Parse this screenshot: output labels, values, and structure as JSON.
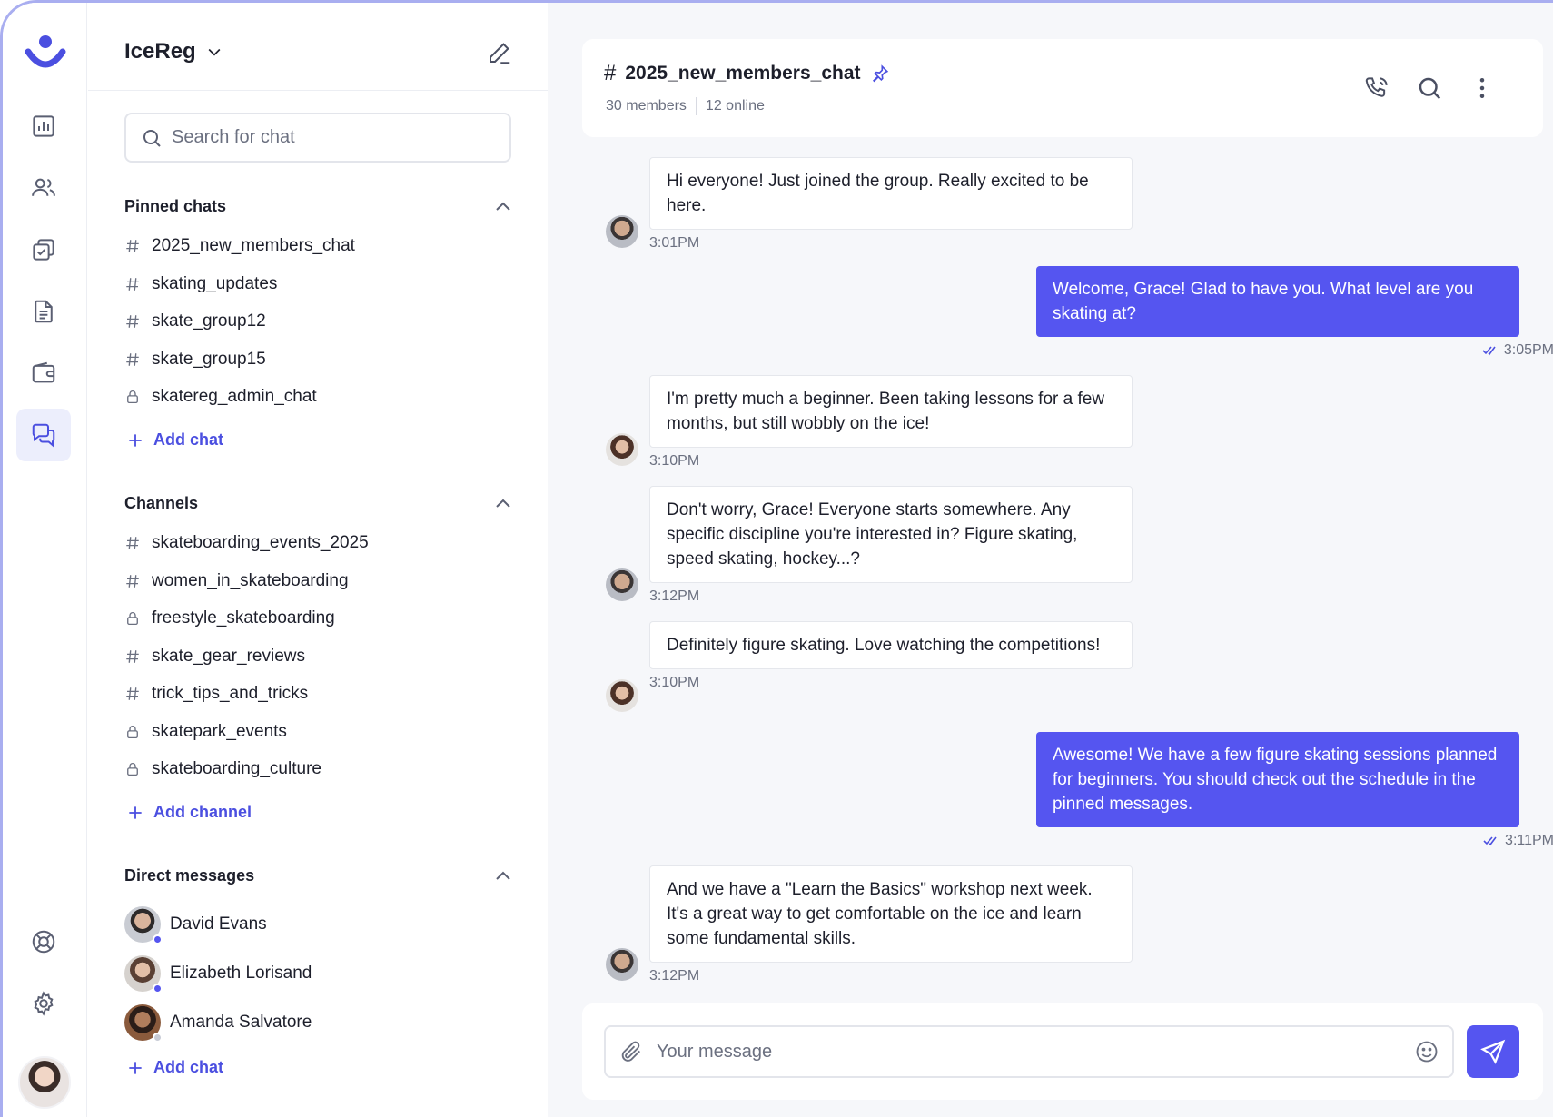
{
  "colors": {
    "accent": "#4b4fe0",
    "bubble_out": "#5555f0",
    "online": "#5555f0",
    "offline": "#c9ccd6"
  },
  "rail": {
    "items": [
      {
        "icon": "dashboard-chart-icon"
      },
      {
        "icon": "members-icon"
      },
      {
        "icon": "checklist-icon"
      },
      {
        "icon": "document-icon"
      },
      {
        "icon": "wallet-icon"
      },
      {
        "icon": "chat-bubbles-icon",
        "active": true
      }
    ],
    "bottom": [
      {
        "icon": "help-lifebuoy-icon"
      },
      {
        "icon": "settings-gear-icon"
      }
    ]
  },
  "sidebar": {
    "workspace": "IceReg",
    "search_placeholder": "Search for chat",
    "pinned": {
      "title": "Pinned chats",
      "items": [
        {
          "label": "2025_new_members_chat",
          "type": "hash"
        },
        {
          "label": "skating_updates",
          "type": "hash"
        },
        {
          "label": "skate_group12",
          "type": "hash"
        },
        {
          "label": "skate_group15",
          "type": "hash"
        },
        {
          "label": "skatereg_admin_chat",
          "type": "lock"
        }
      ],
      "add_label": "Add chat"
    },
    "channels": {
      "title": "Channels",
      "items": [
        {
          "label": "skateboarding_events_2025",
          "type": "hash"
        },
        {
          "label": "women_in_skateboarding",
          "type": "hash"
        },
        {
          "label": "freestyle_skateboarding",
          "type": "lock"
        },
        {
          "label": "skate_gear_reviews",
          "type": "hash"
        },
        {
          "label": "trick_tips_and_tricks",
          "type": "hash"
        },
        {
          "label": "skatepark_events",
          "type": "lock"
        },
        {
          "label": "skateboarding_culture",
          "type": "lock"
        }
      ],
      "add_label": "Add channel"
    },
    "direct": {
      "title": "Direct messages",
      "items": [
        {
          "name": "David Evans",
          "online": true
        },
        {
          "name": "Elizabeth Lorisand",
          "online": true
        },
        {
          "name": "Amanda Salvatore",
          "online": false
        }
      ],
      "add_label": "Add chat"
    }
  },
  "chat": {
    "hash": "#",
    "name": "2025_new_members_chat",
    "members": "30 members",
    "online": "12 online",
    "messages": [
      {
        "dir": "in",
        "text": "Hi everyone! Just joined the group. Really excited to be here.",
        "time": "3:01PM",
        "avatar": "man"
      },
      {
        "dir": "out",
        "text": "Welcome, Grace! Glad to have you. What level are you skating at?",
        "time": "3:05PM"
      },
      {
        "dir": "in",
        "text": "I'm pretty much a beginner.  Been taking lessons for a few months, but still wobbly on the ice!",
        "time": "3:10PM",
        "avatar": "woman"
      },
      {
        "dir": "in",
        "text": "Don't worry, Grace! Everyone starts somewhere.  Any specific discipline you're interested in? Figure skating, speed skating, hockey...?",
        "time": "3:12PM",
        "avatar": "man"
      },
      {
        "dir": "in",
        "text": "Definitely figure skating.  Love watching the competitions!",
        "time": "3:10PM",
        "avatar": "woman"
      },
      {
        "dir": "out",
        "text": "Awesome! We have a few figure skating sessions planned for beginners. You should check out the schedule in the pinned messages.",
        "time": "3:11PM"
      },
      {
        "dir": "in",
        "text": "And we have a \"Learn the Basics\" workshop next week.  It's a great way to get comfortable on the ice and learn some fundamental skills.",
        "time": "3:12PM",
        "avatar": "man"
      }
    ],
    "composer_placeholder": "Your message"
  }
}
